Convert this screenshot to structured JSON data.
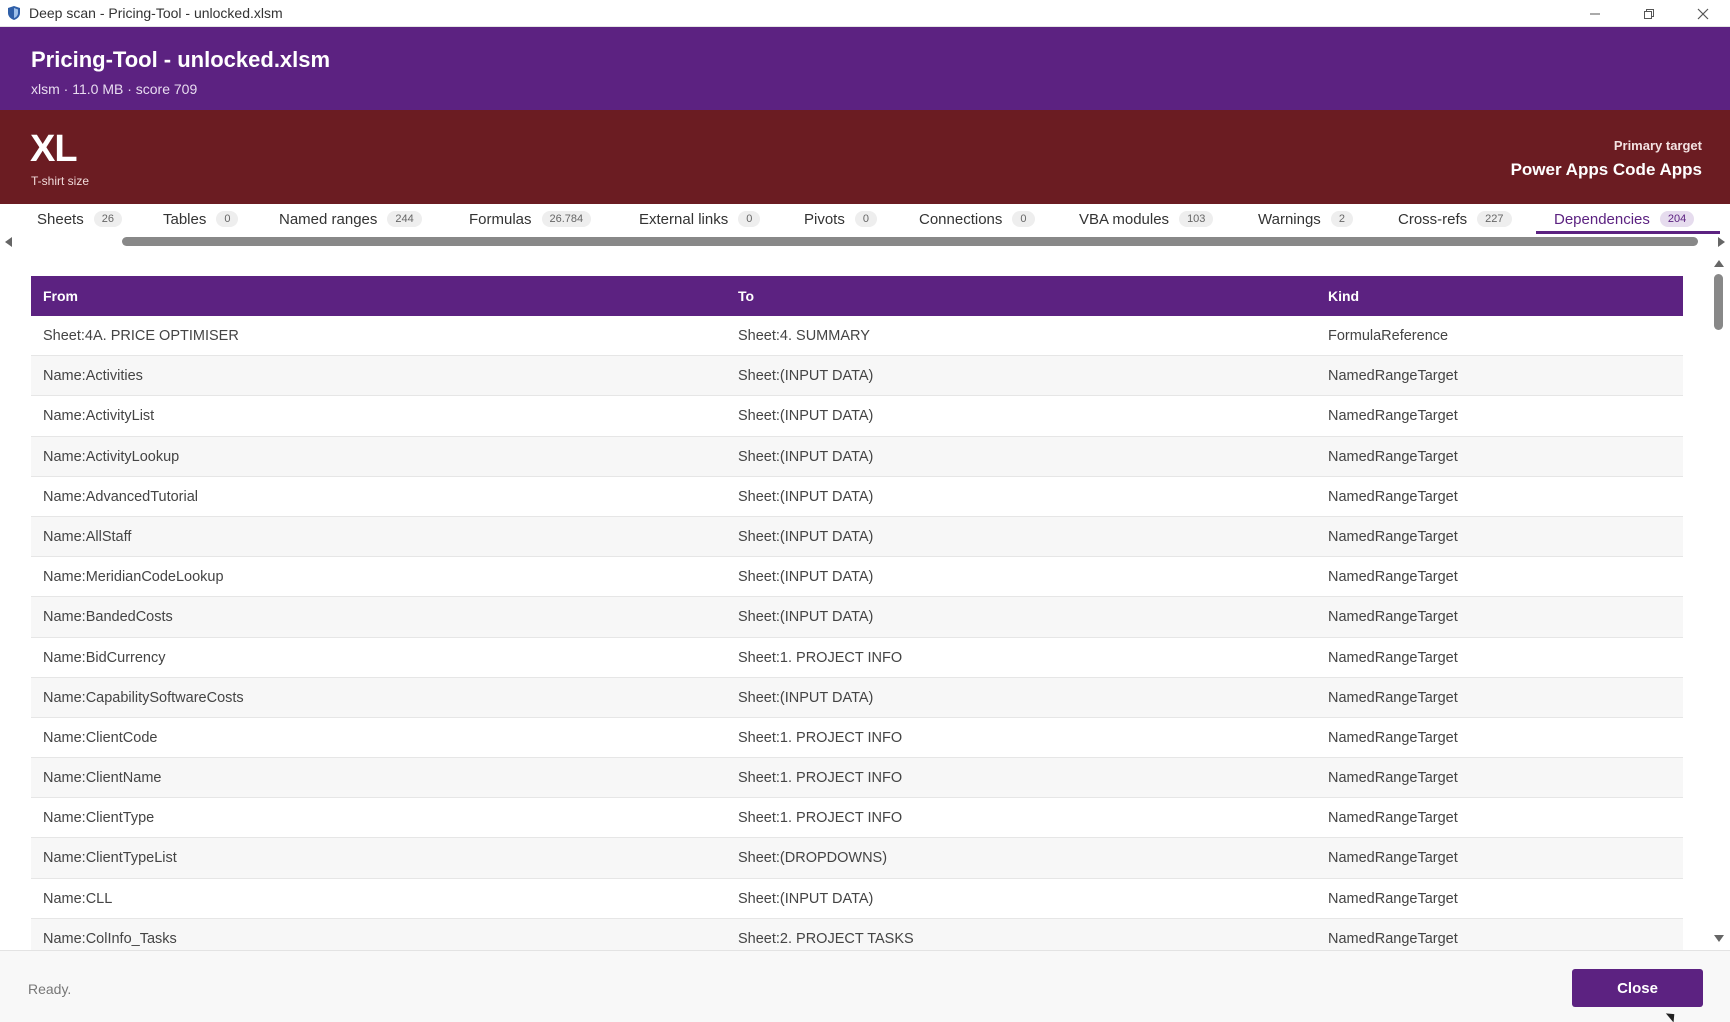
{
  "window": {
    "title": "Deep scan - Pricing-Tool - unlocked.xlsm",
    "minimize_icon": "minimize-icon",
    "maximize_icon": "restore-icon",
    "close_icon": "close-icon"
  },
  "header": {
    "file_title": "Pricing-Tool - unlocked.xlsm",
    "file_meta": "xlsm · 11.0 MB · score 709"
  },
  "band": {
    "size": "XL",
    "size_label": "T-shirt size",
    "target_label": "Primary target",
    "target_value": "Power Apps Code Apps"
  },
  "tabs": [
    {
      "label": "Sheets",
      "count": "26"
    },
    {
      "label": "Tables",
      "count": "0"
    },
    {
      "label": "Named ranges",
      "count": "244"
    },
    {
      "label": "Formulas",
      "count": "26.784"
    },
    {
      "label": "External links",
      "count": "0"
    },
    {
      "label": "Pivots",
      "count": "0"
    },
    {
      "label": "Connections",
      "count": "0"
    },
    {
      "label": "VBA modules",
      "count": "103"
    },
    {
      "label": "Warnings",
      "count": "2"
    },
    {
      "label": "Cross-refs",
      "count": "227"
    },
    {
      "label": "Dependencies",
      "count": "204",
      "active": true
    }
  ],
  "table": {
    "headers": {
      "from": "From",
      "to": "To",
      "kind": "Kind"
    },
    "rows": [
      {
        "from": "Sheet:4A. PRICE OPTIMISER",
        "to": "Sheet:4. SUMMARY",
        "kind": "FormulaReference"
      },
      {
        "from": "Name:Activities",
        "to": "Sheet:(INPUT DATA)",
        "kind": "NamedRangeTarget"
      },
      {
        "from": "Name:ActivityList",
        "to": "Sheet:(INPUT DATA)",
        "kind": "NamedRangeTarget"
      },
      {
        "from": "Name:ActivityLookup",
        "to": "Sheet:(INPUT DATA)",
        "kind": "NamedRangeTarget"
      },
      {
        "from": "Name:AdvancedTutorial",
        "to": "Sheet:(INPUT DATA)",
        "kind": "NamedRangeTarget"
      },
      {
        "from": "Name:AllStaff",
        "to": "Sheet:(INPUT DATA)",
        "kind": "NamedRangeTarget"
      },
      {
        "from": "Name:MeridianCodeLookup",
        "to": "Sheet:(INPUT DATA)",
        "kind": "NamedRangeTarget"
      },
      {
        "from": "Name:BandedCosts",
        "to": "Sheet:(INPUT DATA)",
        "kind": "NamedRangeTarget"
      },
      {
        "from": "Name:BidCurrency",
        "to": "Sheet:1. PROJECT INFO",
        "kind": "NamedRangeTarget"
      },
      {
        "from": "Name:CapabilitySoftwareCosts",
        "to": "Sheet:(INPUT DATA)",
        "kind": "NamedRangeTarget"
      },
      {
        "from": "Name:ClientCode",
        "to": "Sheet:1. PROJECT INFO",
        "kind": "NamedRangeTarget"
      },
      {
        "from": "Name:ClientName",
        "to": "Sheet:1. PROJECT INFO",
        "kind": "NamedRangeTarget"
      },
      {
        "from": "Name:ClientType",
        "to": "Sheet:1. PROJECT INFO",
        "kind": "NamedRangeTarget"
      },
      {
        "from": "Name:ClientTypeList",
        "to": "Sheet:(DROPDOWNS)",
        "kind": "NamedRangeTarget"
      },
      {
        "from": "Name:CLL",
        "to": "Sheet:(INPUT DATA)",
        "kind": "NamedRangeTarget"
      },
      {
        "from": "Name:ColInfo_Tasks",
        "to": "Sheet:2. PROJECT TASKS",
        "kind": "NamedRangeTarget"
      }
    ]
  },
  "footer": {
    "status": "Ready.",
    "close_label": "Close"
  },
  "colors": {
    "header_purple": "#5c2281",
    "band_maroon": "#6b1c22"
  }
}
